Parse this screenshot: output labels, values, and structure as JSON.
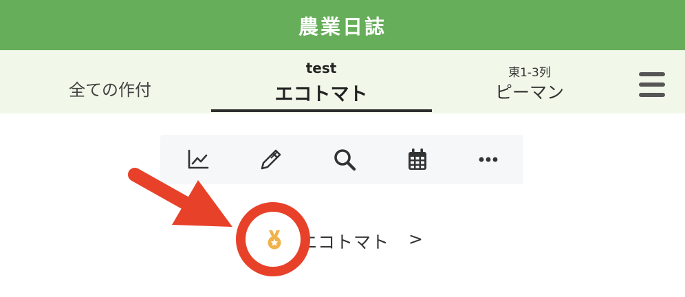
{
  "header": {
    "title": "農業日誌"
  },
  "tabs": [
    {
      "sub": "",
      "label": "全ての作付"
    },
    {
      "sub": "test",
      "label": "エコトマト"
    },
    {
      "sub": "東1-3列",
      "label": "ピーマン"
    }
  ],
  "toolbar": {
    "items": [
      {
        "icon": "chart-line-icon"
      },
      {
        "icon": "pen-icon"
      },
      {
        "icon": "search-icon"
      },
      {
        "icon": "calendar-icon"
      },
      {
        "icon": "more-icon"
      }
    ]
  },
  "crop": {
    "label": "エコトマト",
    "chevron": ">",
    "icon": "medal-icon"
  },
  "colors": {
    "header_bg": "#67ae5b",
    "tabs_bg": "#f1f8e9",
    "annotation": "#e8412a",
    "medal": "#f0b24a"
  }
}
